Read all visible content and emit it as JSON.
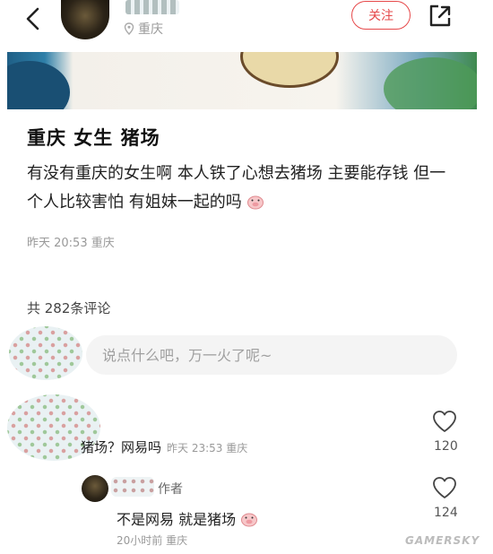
{
  "header": {
    "location": "重庆",
    "follow_label": "关注"
  },
  "post": {
    "title": "重庆 女生 猪场",
    "body": "有没有重庆的女生啊 本人铁了心想去猪场 主要能存钱 但一个人比较害怕 有姐妹一起的吗",
    "meta": "昨天 20:53 重庆"
  },
  "comments_section": {
    "count_label": "共 282条评论",
    "input_placeholder": "说点什么吧，万一火了呢~"
  },
  "comments": [
    {
      "text": "猪场？网易吗",
      "meta": "昨天 23:53 重庆",
      "like_count": "120"
    },
    {
      "author_tag": "作者",
      "text": "不是网易 就是猪场",
      "meta": "20小时前  重庆",
      "like_count": "124"
    }
  ],
  "watermark": "GAMERSKY",
  "icons": [
    "back-icon",
    "share-icon",
    "location-pin-icon",
    "pig-emoji-icon",
    "heart-icon"
  ],
  "colors": {
    "accent": "#e6484a"
  }
}
